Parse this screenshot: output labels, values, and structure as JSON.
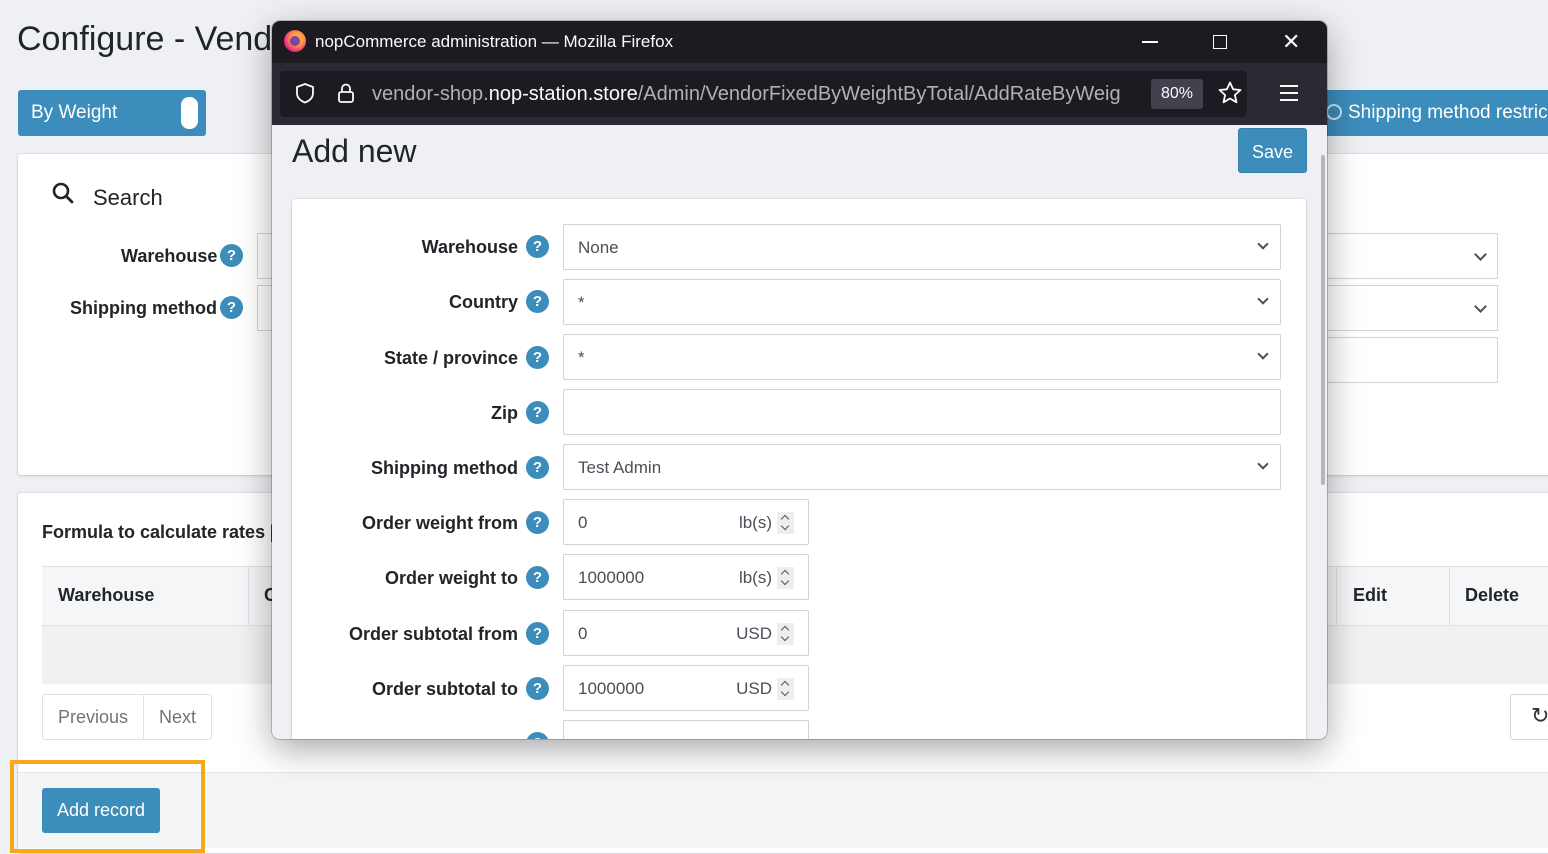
{
  "background": {
    "page_title": "Configure - Vendo",
    "toggle_label": "By Weight",
    "restrict_button": "Shipping method restrict",
    "search": {
      "title": "Search",
      "warehouse_label": "Warehouse",
      "shipping_method_label": "Shipping method"
    },
    "grid": {
      "formula_label": "Formula to calculate rates [",
      "columns": [
        "Warehouse",
        "C",
        "Edit",
        "Delete"
      ],
      "pager": [
        "Previous",
        "Next"
      ],
      "add_record": "Add record"
    }
  },
  "browser": {
    "window_title": "nopCommerce administration — Mozilla Firefox",
    "url_prefix": "vendor-shop.",
    "url_domain": "nop-station.store",
    "url_path": "/Admin/VendorFixedByWeightByTotal/AddRateByWeig",
    "zoom": "80%"
  },
  "form": {
    "title": "Add new",
    "save_label": "Save",
    "fields": {
      "warehouse": {
        "label": "Warehouse",
        "value": "None"
      },
      "country": {
        "label": "Country",
        "value": "*"
      },
      "state": {
        "label": "State / province",
        "value": "*"
      },
      "zip": {
        "label": "Zip",
        "value": ""
      },
      "shipping_method": {
        "label": "Shipping method",
        "value": "Test Admin"
      },
      "weight_from": {
        "label": "Order weight from",
        "value": "0",
        "unit": "lb(s)"
      },
      "weight_to": {
        "label": "Order weight to",
        "value": "1000000",
        "unit": "lb(s)"
      },
      "subtotal_from": {
        "label": "Order subtotal from",
        "value": "0",
        "unit": "USD"
      },
      "subtotal_to": {
        "label": "Order subtotal to",
        "value": "1000000",
        "unit": "USD"
      }
    },
    "help_glyph": "?"
  },
  "colors": {
    "primary": "#3c8dbc",
    "highlight": "#f6a71a",
    "firefox_titlebar": "#1c1b22",
    "firefox_toolbar": "#2b2a33"
  }
}
